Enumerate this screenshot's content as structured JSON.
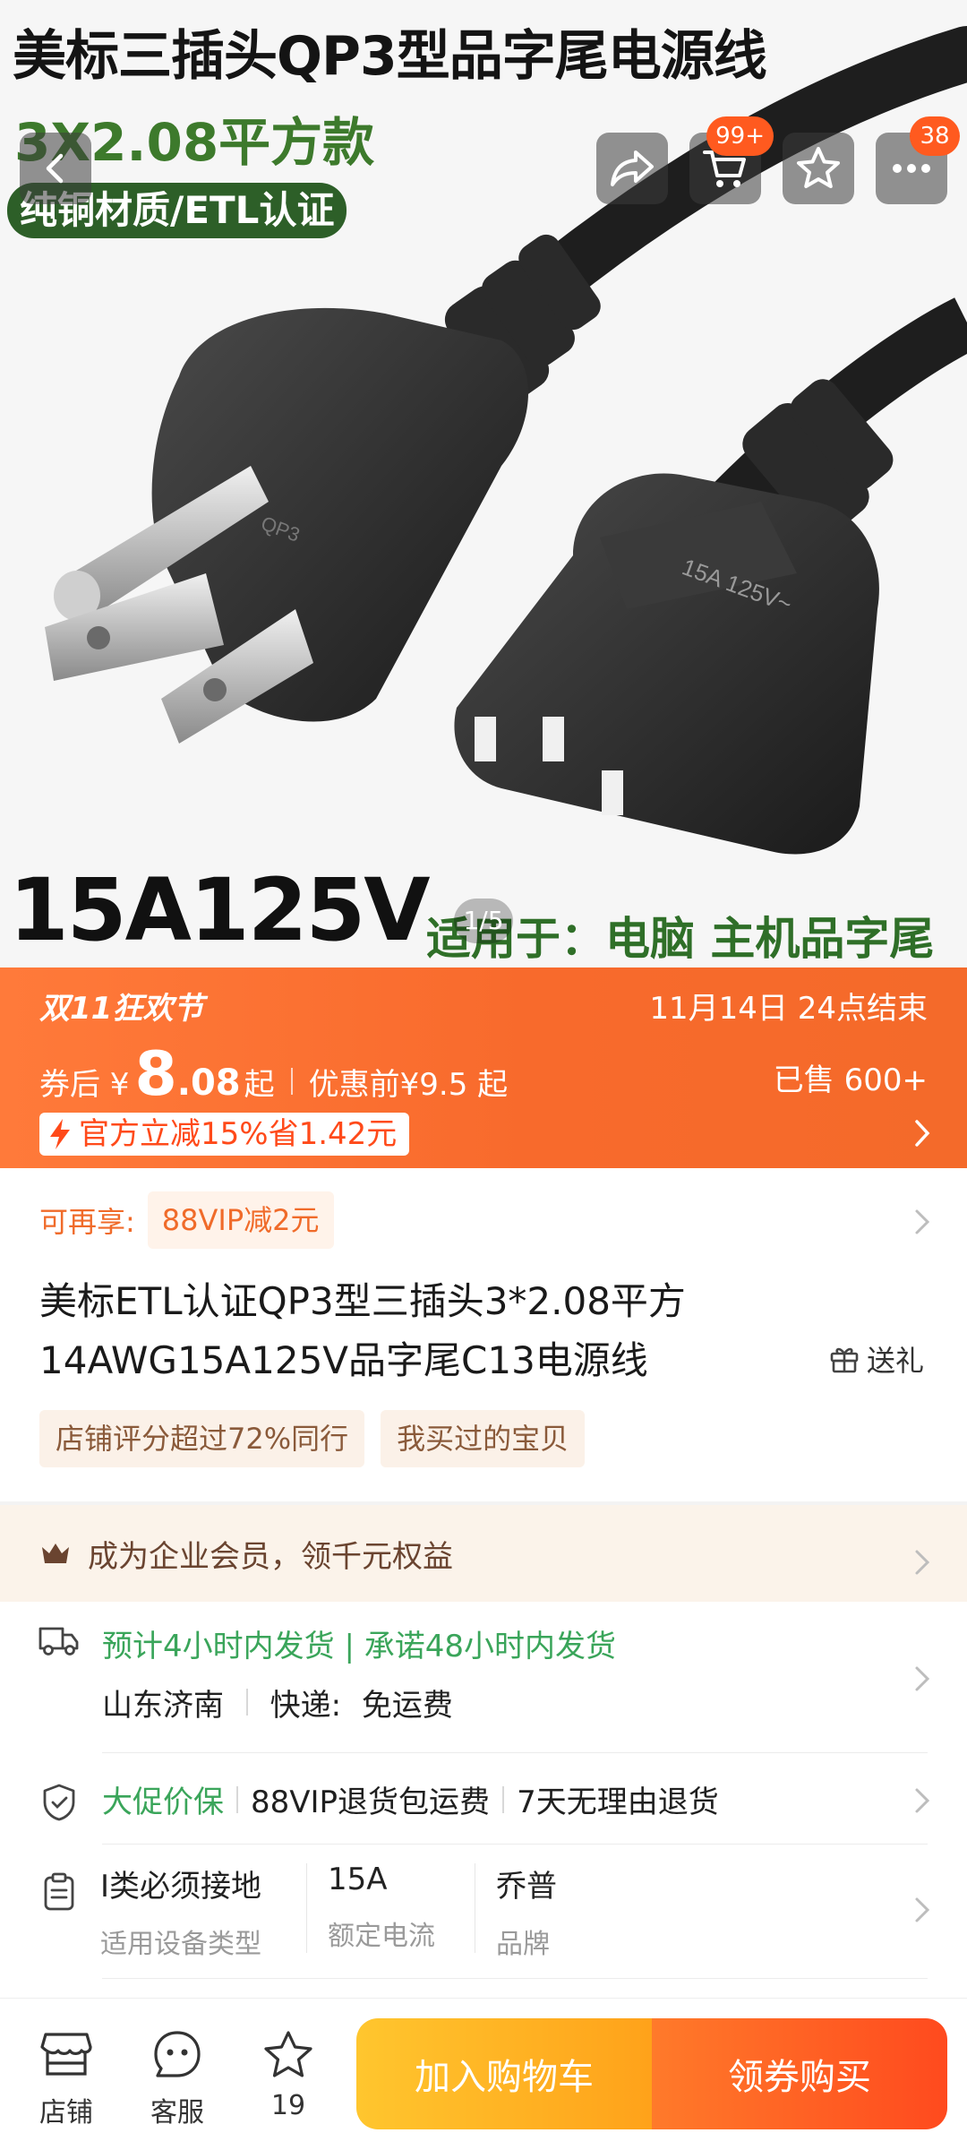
{
  "hero": {
    "title": "美标三插头QP3型品字尾电源线",
    "subtitle": "3X2.08平方款",
    "pill": "纯铜材质/ETL认证",
    "bottom_left": "15A125V",
    "bottom_right": "适用于：电脑 主机品字尾",
    "pager": "1/5",
    "cart_badge": "99+",
    "more_badge": "38",
    "plug_texts": [
      "QP3",
      "15A 125V~"
    ]
  },
  "promo": {
    "brand": "双11狂欢节",
    "date": "11月14日 24点结束",
    "after_label": "券后 ¥",
    "price_big": "8",
    "price_small": ".08",
    "price_suffix": "起",
    "before": "优惠前¥9.5 起",
    "sold": "已售 600+",
    "tag": "官方立减15%省1.42元"
  },
  "vip": {
    "label": "可再享:",
    "chip": "88VIP减2元"
  },
  "product": {
    "title_line1": "美标ETL认证QP3型三插头3*2.08平方",
    "title_line2": "14AWG15A125V品字尾C13电源线",
    "gift": "送礼",
    "chips": [
      "店铺评分超过72%同行",
      "我买过的宝贝"
    ]
  },
  "enterprise": {
    "text": "成为企业会员，领千元权益"
  },
  "shipping": {
    "line1": "预计4小时内发货 | 承诺48小时内发货",
    "origin": "山东济南",
    "express_label": "快递:",
    "express_value": "免运费"
  },
  "guarantee": {
    "green": "大促价保",
    "item2": "88VIP退货包运费",
    "item3": "7天无理由退货"
  },
  "params": [
    {
      "value": "I类必须接地",
      "key": "适用设备类型"
    },
    {
      "value": "15A",
      "key": "额定电流"
    },
    {
      "value": "乔普",
      "key": "品牌"
    }
  ],
  "bottombar": {
    "shop": "店铺",
    "service": "客服",
    "fav_count": "19",
    "add_cart": "加入购物车",
    "buy": "领券购买"
  },
  "colors": {
    "promo": "#f86a2c",
    "green": "#3aa55a",
    "cta_yellow": "#ffb320",
    "cta_orange": "#ff5a24"
  }
}
